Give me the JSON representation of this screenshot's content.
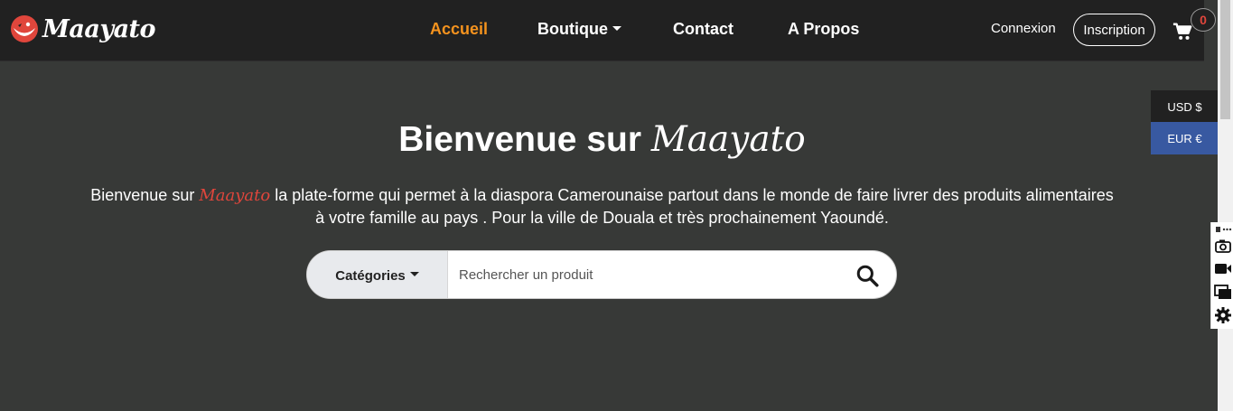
{
  "brand": {
    "name": "Maayato"
  },
  "nav": {
    "items": [
      {
        "label": "Accueil",
        "active": true
      },
      {
        "label": "Boutique",
        "dropdown": true
      },
      {
        "label": "Contact"
      },
      {
        "label": "A Propos"
      }
    ],
    "login": "Connexion",
    "signup": "Inscription",
    "cart_count": "0"
  },
  "currencies": {
    "usd": "USD $",
    "eur": "EUR €",
    "selected": "EUR €"
  },
  "hero": {
    "title_prefix": "Bienvenue sur",
    "title_brand": "Maayato",
    "text_prefix": "Bienvenue sur",
    "text_brand": "Maayato",
    "text_rest": "la plate-forme qui permet à la diaspora Camerounaise partout dans le monde de faire livrer des produits alimentaires à votre famille au pays . Pour la ville de Douala et très prochainement Yaoundé."
  },
  "search": {
    "category_label": "Catégories",
    "placeholder": "Rechercher un produit",
    "value": ""
  },
  "colors": {
    "accent_orange": "#f5931e",
    "brand_red": "#e0463c",
    "navbar": "#212121",
    "hero_bg": "#373937",
    "currency_active": "#3859a1"
  },
  "icons": [
    "maayato-logo-icon",
    "caret-down-icon",
    "cart-icon",
    "search-icon",
    "camera-icon",
    "video-icon",
    "windows-icon",
    "gear-icon",
    "dots-icon"
  ]
}
